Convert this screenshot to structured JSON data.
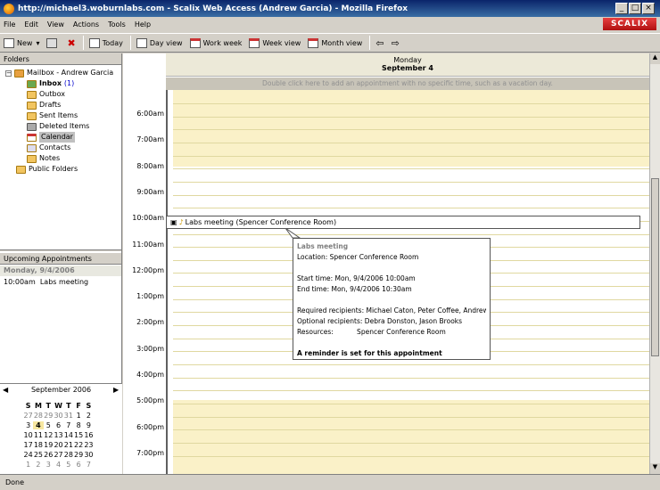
{
  "window": {
    "title": "http://michael3.woburnlabs.com - Scalix Web Access (Andrew Garcia) - Mozilla Firefox"
  },
  "menu": [
    "File",
    "Edit",
    "View",
    "Actions",
    "Tools",
    "Help"
  ],
  "brand": "SCALIX",
  "toolbar": {
    "new": "New",
    "today": "Today",
    "day_view": "Day view",
    "work_week": "Work week",
    "week_view": "Week view",
    "month_view": "Month view"
  },
  "folders": {
    "header": "Folders",
    "mailbox": "Mailbox - Andrew Garcia",
    "inbox": "Inbox",
    "inbox_count": "(1)",
    "outbox": "Outbox",
    "drafts": "Drafts",
    "sent": "Sent Items",
    "deleted": "Deleted Items",
    "calendar": "Calendar",
    "contacts": "Contacts",
    "notes": "Notes",
    "public": "Public Folders"
  },
  "upcoming": {
    "header": "Upcoming Appointments",
    "day": "Monday, 9/4/2006",
    "item": "10:00am  Labs meeting"
  },
  "minical": {
    "month": "September 2006",
    "dow": [
      "S",
      "M",
      "T",
      "W",
      "T",
      "F",
      "S"
    ],
    "weeks": [
      [
        "27",
        "28",
        "29",
        "30",
        "31",
        "1",
        "2"
      ],
      [
        "3",
        "4",
        "5",
        "6",
        "7",
        "8",
        "9"
      ],
      [
        "10",
        "11",
        "12",
        "13",
        "14",
        "15",
        "16"
      ],
      [
        "17",
        "18",
        "19",
        "20",
        "21",
        "22",
        "23"
      ],
      [
        "24",
        "25",
        "26",
        "27",
        "28",
        "29",
        "30"
      ],
      [
        "1",
        "2",
        "3",
        "4",
        "5",
        "6",
        "7"
      ]
    ]
  },
  "day": {
    "weekday": "Monday",
    "date": "September 4"
  },
  "allday_hint": "Double click here to add an appointment with no specific time, such as a vacation day.",
  "hours": [
    "6:00am",
    "7:00am",
    "8:00am",
    "9:00am",
    "10:00am",
    "11:00am",
    "12:00pm",
    "1:00pm",
    "2:00pm",
    "3:00pm",
    "4:00pm",
    "5:00pm",
    "6:00pm",
    "7:00pm"
  ],
  "appointment": {
    "label": "Labs meeting (Spencer Conference Room)"
  },
  "tooltip": {
    "title": "Labs meeting",
    "location": "Location: Spencer Conference Room",
    "start": "Start time:  Mon, 9/4/2006 10:00am",
    "end": "End time:   Mon, 9/4/2006 10:30am",
    "required": "Required recipients: Michael Caton, Peter Coffee, Andrew",
    "optional": "Optional recipients:  Debra Donston, Jason Brooks",
    "resources": "Resources:           Spencer Conference Room",
    "reminder": "A reminder is set for this appointment"
  },
  "status": "Done"
}
